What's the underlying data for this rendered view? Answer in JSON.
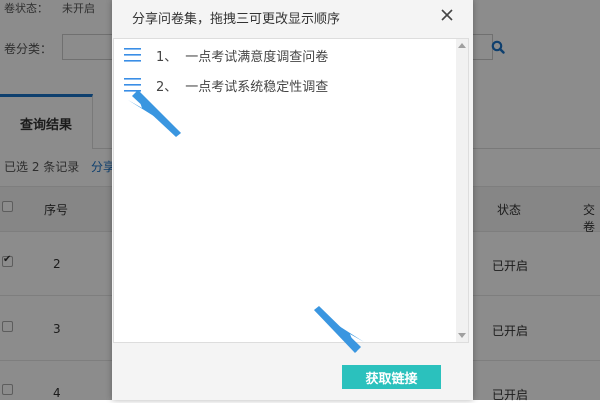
{
  "background": {
    "status_label": "卷状态：",
    "status_value": "未开启",
    "category_label": "卷分类：",
    "tab_label": "查询结果",
    "selected_text": "已选 2 条记录",
    "share_link": "分享",
    "table": {
      "headers": [
        "序号",
        "状态",
        "交卷"
      ],
      "rows": [
        {
          "index": "2",
          "status": "已开启",
          "checked": true
        },
        {
          "index": "3",
          "status": "已开启",
          "checked": false
        },
        {
          "index": "4",
          "status": "已开启",
          "checked": false
        }
      ]
    }
  },
  "modal": {
    "title": "分享问卷集，拖拽三可更改显示顺序",
    "items": [
      {
        "number": "1、",
        "name": "一点考试满意度调查问卷"
      },
      {
        "number": "2、",
        "name": "一点考试系统稳定性调查"
      }
    ],
    "get_link_label": "获取链接"
  },
  "colors": {
    "accent": "#2bc1bd",
    "handle": "#3a8ee6",
    "annotation_arrow": "#3a96e0",
    "tab_active": "#1a73c8"
  },
  "icons": {
    "drag": "drag-handle-icon",
    "close": "close-icon",
    "search": "search-icon"
  }
}
